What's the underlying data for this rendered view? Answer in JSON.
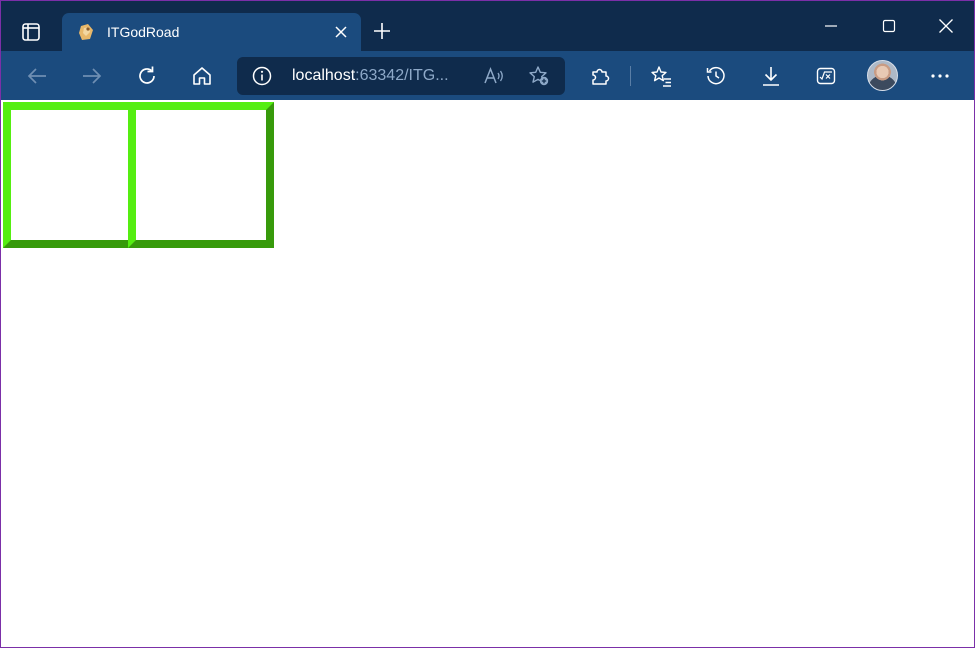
{
  "browser": {
    "tab": {
      "title": "ITGodRoad"
    },
    "address": {
      "host": "localhost",
      "path": ":63342/ITG..."
    },
    "icons": {
      "tab_actions": "tab-actions-icon",
      "favicon": "itgodroad-favicon",
      "tab_close": "close-icon",
      "new_tab": "plus-icon",
      "minimize": "minimize-icon",
      "maximize": "maximize-icon",
      "close_window": "close-icon",
      "back": "arrow-left-icon",
      "forward": "arrow-right-icon",
      "refresh": "refresh-icon",
      "home": "home-icon",
      "site_info": "info-icon",
      "read_aloud": "read-aloud-icon",
      "add_favorite": "star-add-icon",
      "extensions": "puzzle-icon",
      "favorites": "favorites-list-icon",
      "history": "history-icon",
      "downloads": "download-icon",
      "math_solver": "math-solver-icon",
      "menu": "more-icon"
    }
  },
  "page": {
    "boxes": [
      {
        "label": "box-1"
      },
      {
        "label": "box-2"
      }
    ]
  },
  "colors": {
    "tabstrip": "#0f2b4c",
    "toolbar": "#1b4b7e",
    "box_border": "#55ee11"
  }
}
